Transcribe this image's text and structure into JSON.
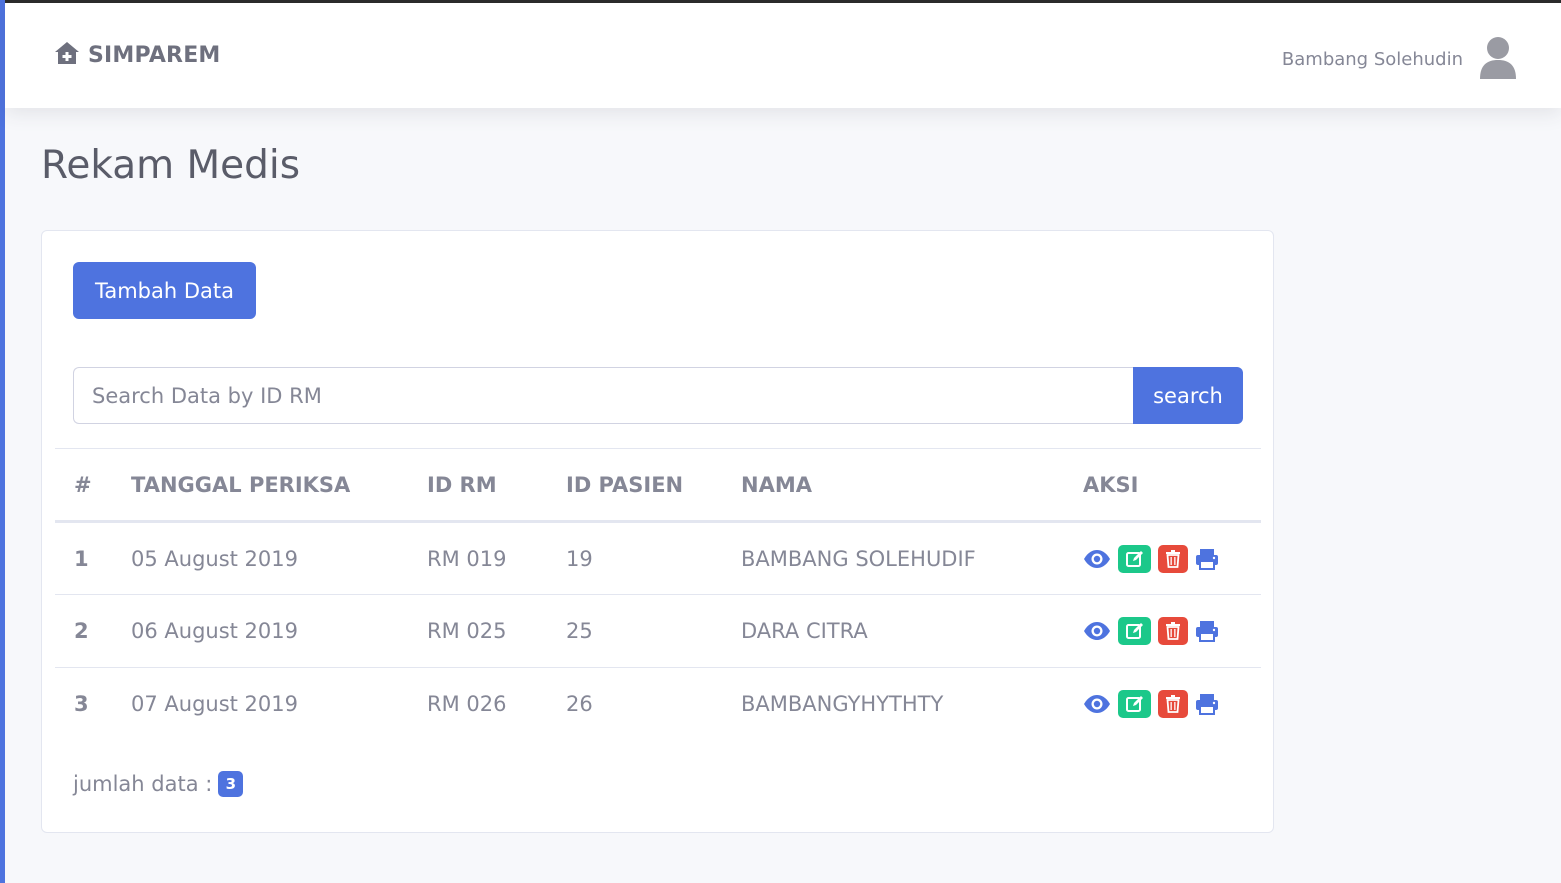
{
  "brand": {
    "name": "SIMPAREM",
    "icon": "home-plus-icon"
  },
  "user": {
    "name": "Bambang Solehudin",
    "icon": "user-avatar-icon"
  },
  "page": {
    "title": "Rekam Medis"
  },
  "actions": {
    "add_label": "Tambah Data"
  },
  "search": {
    "placeholder": "Search Data by ID RM",
    "value": "",
    "button_label": "search"
  },
  "table": {
    "headers": {
      "no": "#",
      "date": "TANGGAL PERIKSA",
      "id_rm": "ID RM",
      "id_pasien": "ID PASIEN",
      "nama": "NAMA",
      "aksi": "AKSI"
    },
    "rows": [
      {
        "no": "1",
        "date": "05 August 2019",
        "id_rm": "RM 019",
        "id_pasien": "19",
        "nama": "BAMBANG SOLEHUDIF"
      },
      {
        "no": "2",
        "date": "06 August 2019",
        "id_rm": "RM 025",
        "id_pasien": "25",
        "nama": "DARA CITRA"
      },
      {
        "no": "3",
        "date": "07 August 2019",
        "id_rm": "RM 026",
        "id_pasien": "26",
        "nama": "BAMBANGYHYTHTY"
      }
    ],
    "row_action_icons": [
      "eye-icon",
      "edit-icon",
      "trash-icon",
      "print-icon"
    ]
  },
  "footer": {
    "count_label": "jumlah data :",
    "count": "3"
  },
  "colors": {
    "primary": "#4e73df",
    "success": "#1cc88a",
    "danger": "#e74a3b",
    "text": "#858796"
  }
}
